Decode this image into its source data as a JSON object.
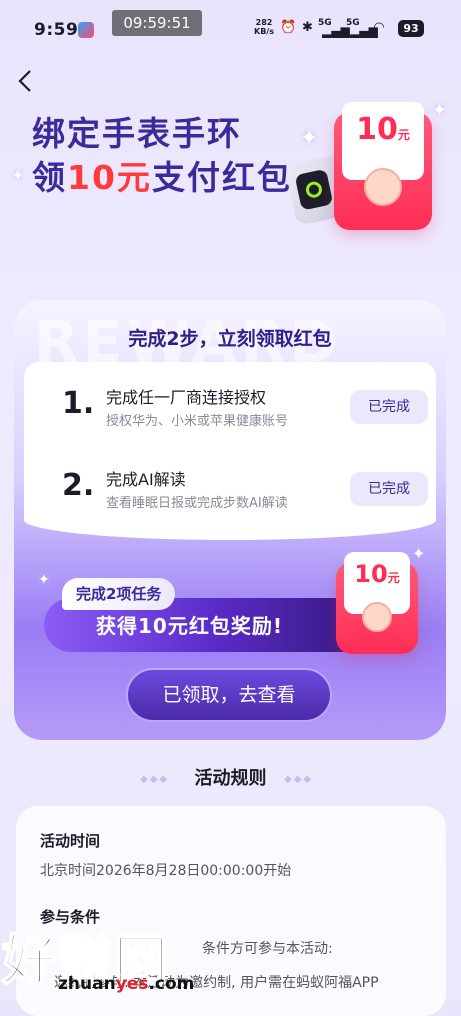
{
  "status_bar": {
    "time": "9:59",
    "clock_overlay": "09:59:51",
    "net_speed_value": "282",
    "net_speed_unit": "KB/s",
    "signal1": "5G",
    "signal2": "5G",
    "battery": "93"
  },
  "hero": {
    "title_line1": "绑定手表手环",
    "title_line2_prefix": "领",
    "title_line2_amount": "10元",
    "title_line2_suffix": "支付红包",
    "redpack_amount": "10",
    "redpack_unit": "元"
  },
  "main": {
    "watermark_word": "REWARD",
    "heading": "完成2步，立刻领取红包",
    "steps": [
      {
        "num": "1.",
        "title": "完成任一厂商连接授权",
        "desc": "授权华为、小米或苹果健康账号",
        "status": "已完成"
      },
      {
        "num": "2.",
        "title": "完成AI解读",
        "desc": "查看睡眠日报或完成步数AI解读",
        "status": "已完成"
      }
    ],
    "reward_tag": "完成2项任务",
    "reward_text": "获得10元红包奖励!",
    "reward_pack_amount": "10",
    "reward_pack_unit": "元",
    "claim_button": "已领取，去查看"
  },
  "rules": {
    "title": "活动规则",
    "time_label": "活动时间",
    "time_value": "北京时间2026年8月28日00:00:00开始",
    "cond_label": "参与条件",
    "cond_line1": "条件方可参与本活动:",
    "cond_line2": "邀约制参与: 本活动为邀约制, 用户需在蚂蚁阿福APP"
  },
  "watermark": {
    "text": "好赚网",
    "url_prefix": "zhuan",
    "url_mid": "yes",
    "url_suffix": ".com"
  }
}
